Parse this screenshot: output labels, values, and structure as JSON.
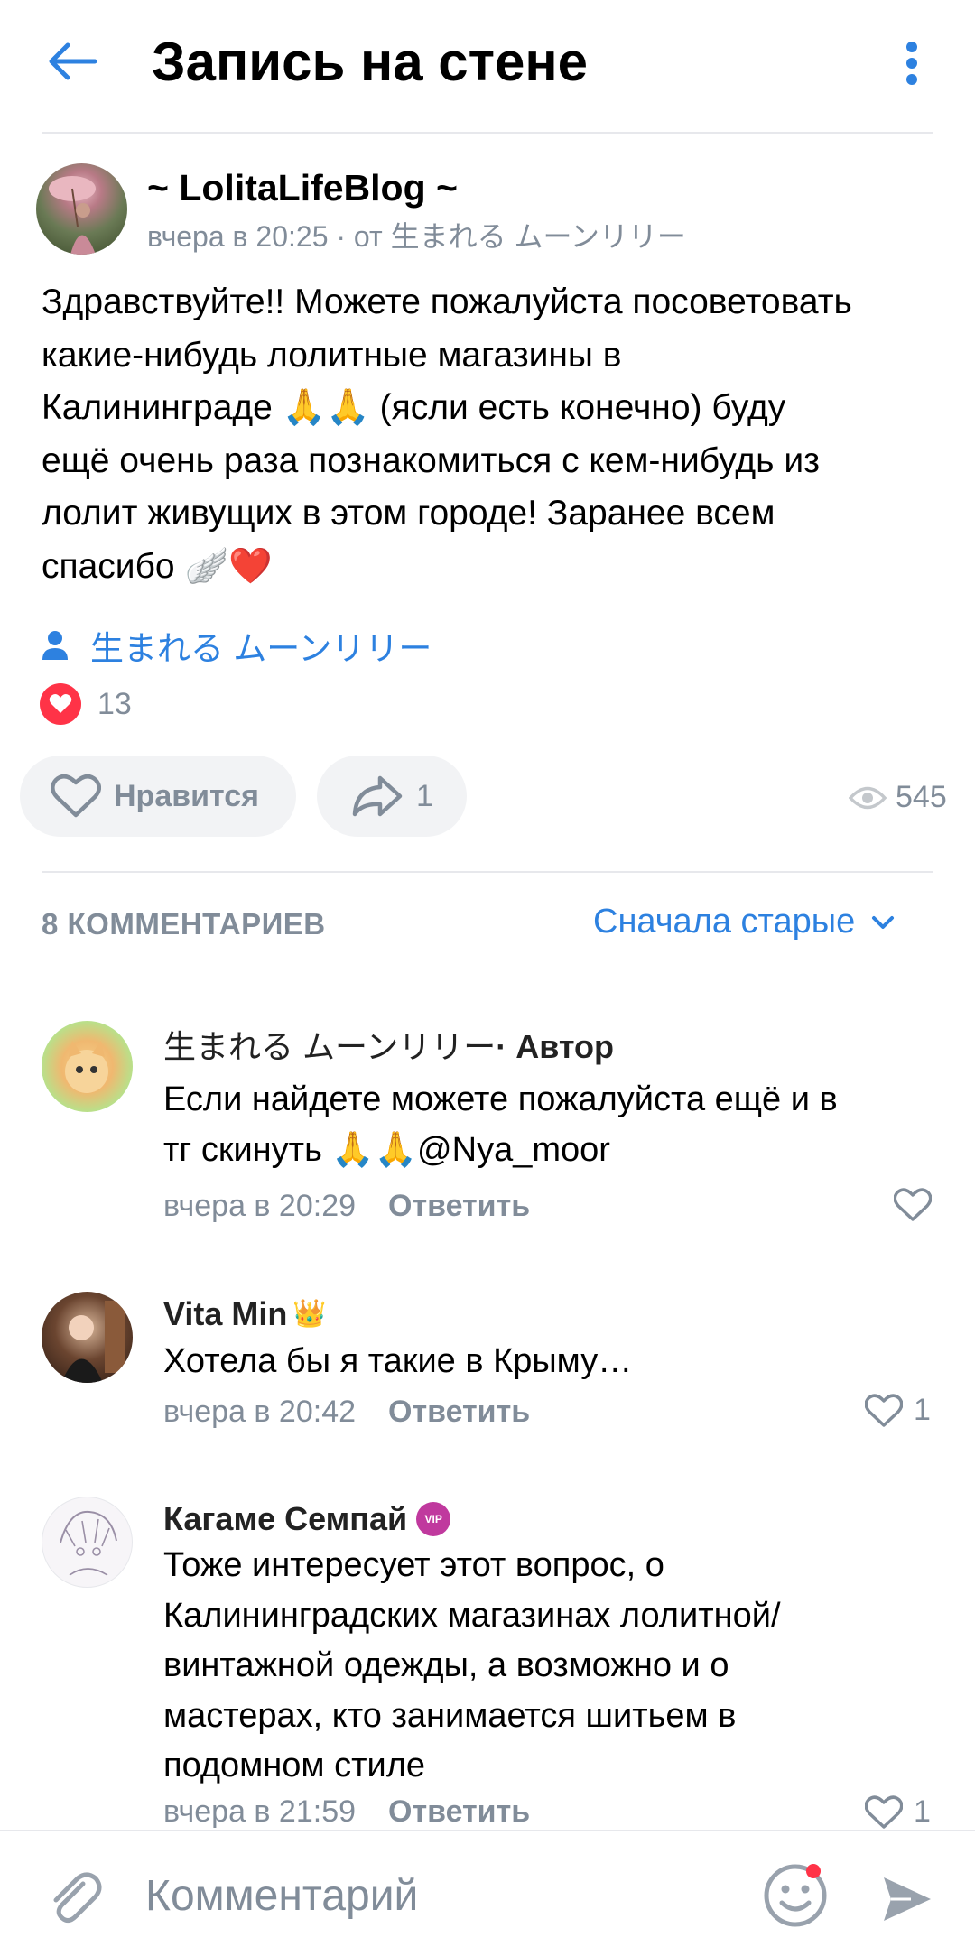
{
  "header": {
    "title": "Запись на стене"
  },
  "post": {
    "author": "~ LolitaLifeBlog ~",
    "meta": "вчера в 20:25 · от 生まれる ムーンリリー",
    "text": "Здравствуйте!! Можете пожалуйста посоветовать\nкакие-нибудь лолитные магазины в\nКалининграде 🙏🙏 (ясли есть конечно) буду\nещё очень раза познакомиться с кем-нибудь из\nлолит живущих в этом городе! Заранее всем\nспасибо 🪽❤️",
    "signer": "生まれる ムーンリリー",
    "likes_count": "13",
    "like_label": "Нравится",
    "shares_count": "1",
    "views_count": "545"
  },
  "comments_section": {
    "header": "8 КОММЕНТАРИЕВ",
    "sort_label": "Сначала старые"
  },
  "comments": [
    {
      "name": "生まれる ムーンリリー",
      "badge": " · Автор",
      "text": "Если найдете можете пожалуйста ещё и в\nтг скинуть 🙏🙏@Nya_moor",
      "time": "вчера в 20:29",
      "reply": "Ответить",
      "likes": ""
    },
    {
      "name": "Vita Min",
      "badge": "👑",
      "text": "Хотела бы я такие в Крыму…",
      "time": "вчера в 20:42",
      "reply": "Ответить",
      "likes": "1"
    },
    {
      "name": "Кагаме Семпай",
      "badge": "VIP",
      "text": "Тоже интересует этот вопрос, о\nКалининградских магазинах лолитной/\nвинтажной одежды, а возможно и о\nмастерах, кто занимается шитьем в\nподомном стиле",
      "time": "вчера в 21:59",
      "reply": "Ответить",
      "likes": "1"
    }
  ],
  "composer": {
    "placeholder": "Комментарий"
  },
  "colors": {
    "accent": "#2d81e0",
    "secondary_text": "#818c99",
    "like_red": "#ff3347",
    "pill_bg": "#f2f3f5"
  }
}
